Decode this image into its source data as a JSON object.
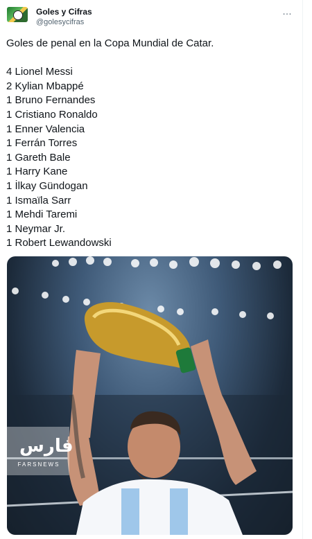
{
  "account": {
    "name": "Goles y Cifras",
    "handle": "@golesycifras",
    "more_icon": "…"
  },
  "tweet": {
    "intro": "Goles de penal en la Copa Mundial de Catar.",
    "lines": [
      "4 Lionel Messi",
      "2 Kylian Mbappé",
      "1 Bruno Fernandes",
      "1 Cristiano Ronaldo",
      "1 Enner Valencia",
      "1 Ferrán Torres",
      "1 Gareth Bale",
      "1 Harry Kane",
      "1 İlkay Gündogan",
      "1 Ismaïla Sarr",
      "1 Mehdi Taremi",
      "1 Neymar Jr.",
      "1 Robert Lewandowski"
    ]
  },
  "media": {
    "watermark_logo": "فارس",
    "watermark_text": "FARSNEWS"
  }
}
